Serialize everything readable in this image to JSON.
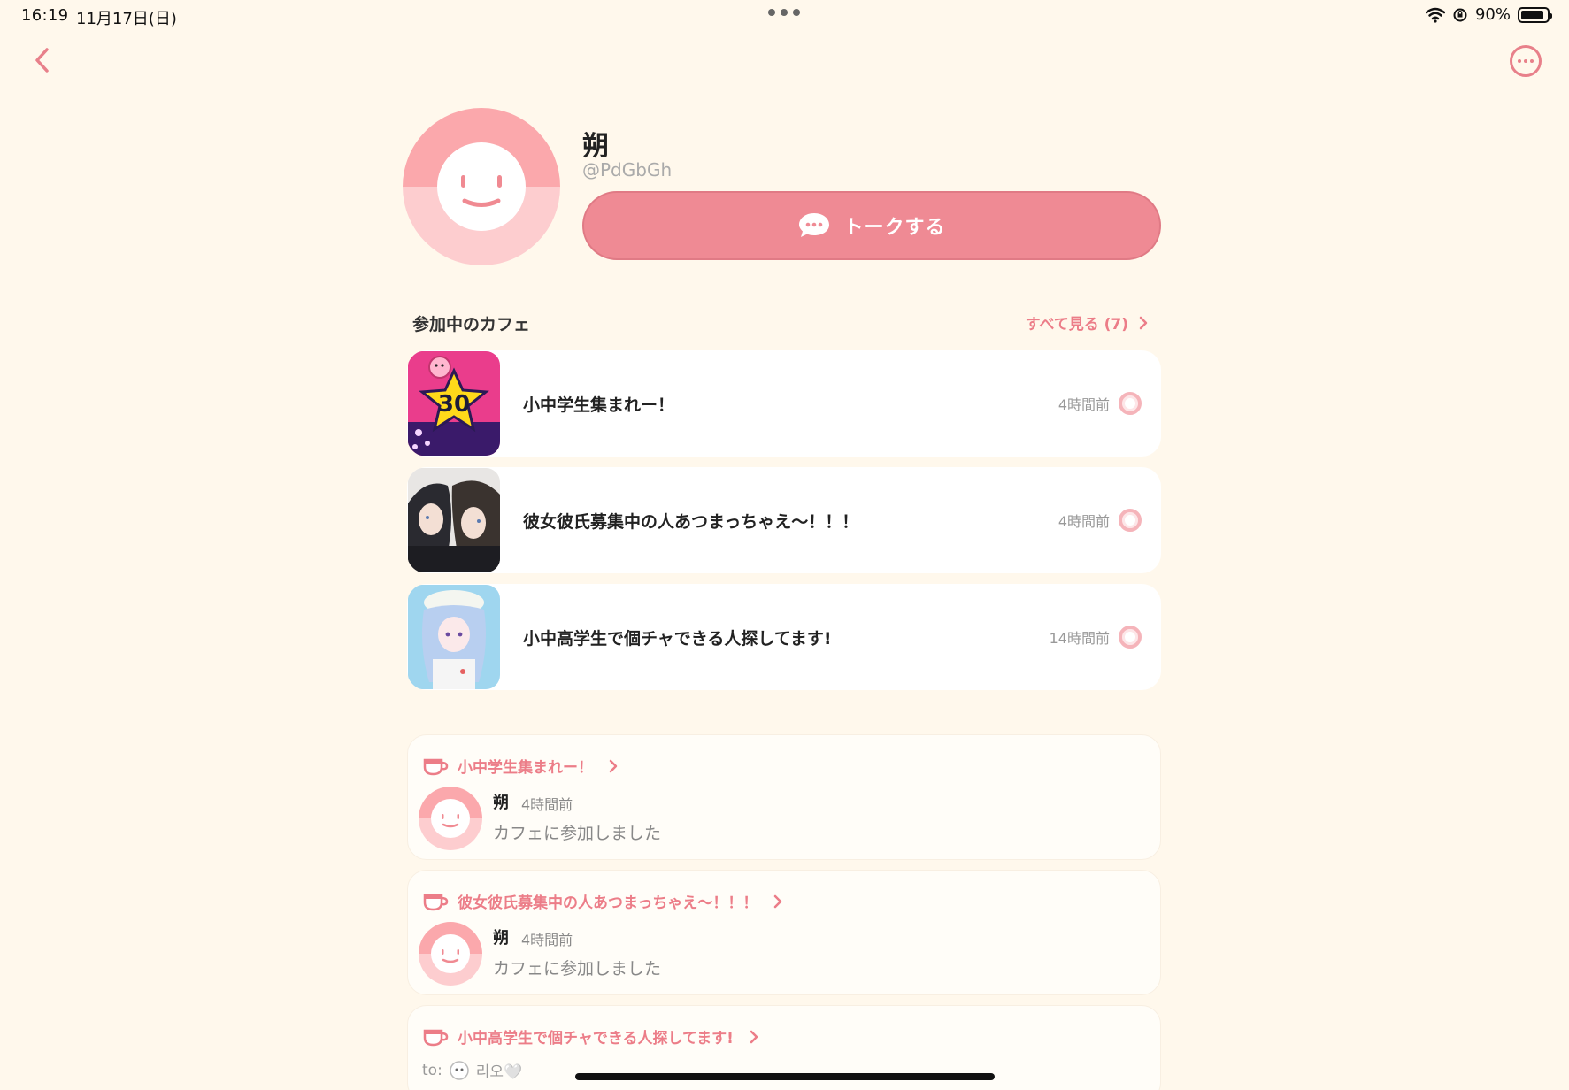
{
  "status_bar": {
    "time": "16:19",
    "date": "11月17日(日)",
    "battery": "90%",
    "battery_level": 0.9
  },
  "profile": {
    "name": "朔",
    "handle": "@PdGbGh",
    "talk_button_label": "トークする"
  },
  "cafes_section": {
    "title": "参加中のカフェ",
    "see_all_label": "すべて見る (7)",
    "items": [
      {
        "name": "小中学生集まれー！",
        "time": "4時間前"
      },
      {
        "name": "彼女彼氏募集中の人あつまっちゃえ〜！！！",
        "time": "4時間前"
      },
      {
        "name": "小中高学生で個チャできる人探してます!",
        "time": "14時間前"
      }
    ]
  },
  "activity": [
    {
      "cafe": "小中学生集まれー！",
      "user": "朔",
      "time": "4時間前",
      "text": "カフェに参加しました"
    },
    {
      "cafe": "彼女彼氏募集中の人あつまっちゃえ〜！！！",
      "user": "朔",
      "time": "4時間前",
      "text": "カフェに参加しました"
    },
    {
      "cafe": "小中高学生で個チャできる人探してます!",
      "to_prefix": "to:",
      "to_name": "리오🤍"
    }
  ],
  "colors": {
    "background": "#fff8ec",
    "accent": "#ec7d88",
    "button": "#ef8a94"
  }
}
